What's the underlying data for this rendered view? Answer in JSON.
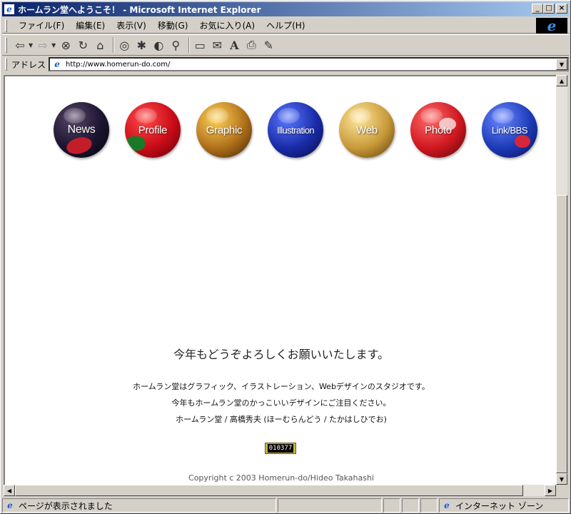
{
  "window": {
    "title": "ホームラン堂へようこそ！ - Microsoft Internet Explorer",
    "min_glyph": "_",
    "max_glyph": "□",
    "close_glyph": "×"
  },
  "menu": {
    "items": [
      "ファイル(F)",
      "編集(E)",
      "表示(V)",
      "移動(G)",
      "お気に入り(A)",
      "ヘルプ(H)"
    ]
  },
  "toolbar": {
    "icons": [
      "back-icon",
      "forward-icon",
      "stop-icon",
      "refresh-icon",
      "home-icon",
      "search-icon",
      "favorites-icon",
      "history-icon",
      "channels-icon",
      "fullscreen-icon",
      "mail-icon",
      "font-icon",
      "print-icon",
      "edit-icon"
    ]
  },
  "address": {
    "label": "アドレス",
    "url": "http://www.homerun-do.com/"
  },
  "page": {
    "nav": [
      "News",
      "Profile",
      "Graphic",
      "Illustration",
      "Web",
      "Photo",
      "Link/BBS"
    ],
    "greeting": "今年もどうぞよろしくお願いいたします。",
    "line1": "ホームラン堂はグラフィック、イラストレーション、Webデザインのスタジオです。",
    "line2": "今年もホームラン堂のかっこいいデザインにご注目ください。",
    "line3": "ホームラン堂 / 高橋秀夫 (ほーむらんどう / たかはしひでお)",
    "counter": "010377",
    "copyright": "Copyright c 2003 Homerun-do/Hideo Takahashi"
  },
  "status": {
    "text": "ページが表示されました",
    "zone": "インターネット ゾーン"
  },
  "colors": {
    "title_bar": "#0a246a",
    "chrome": "#d4d0c8"
  }
}
